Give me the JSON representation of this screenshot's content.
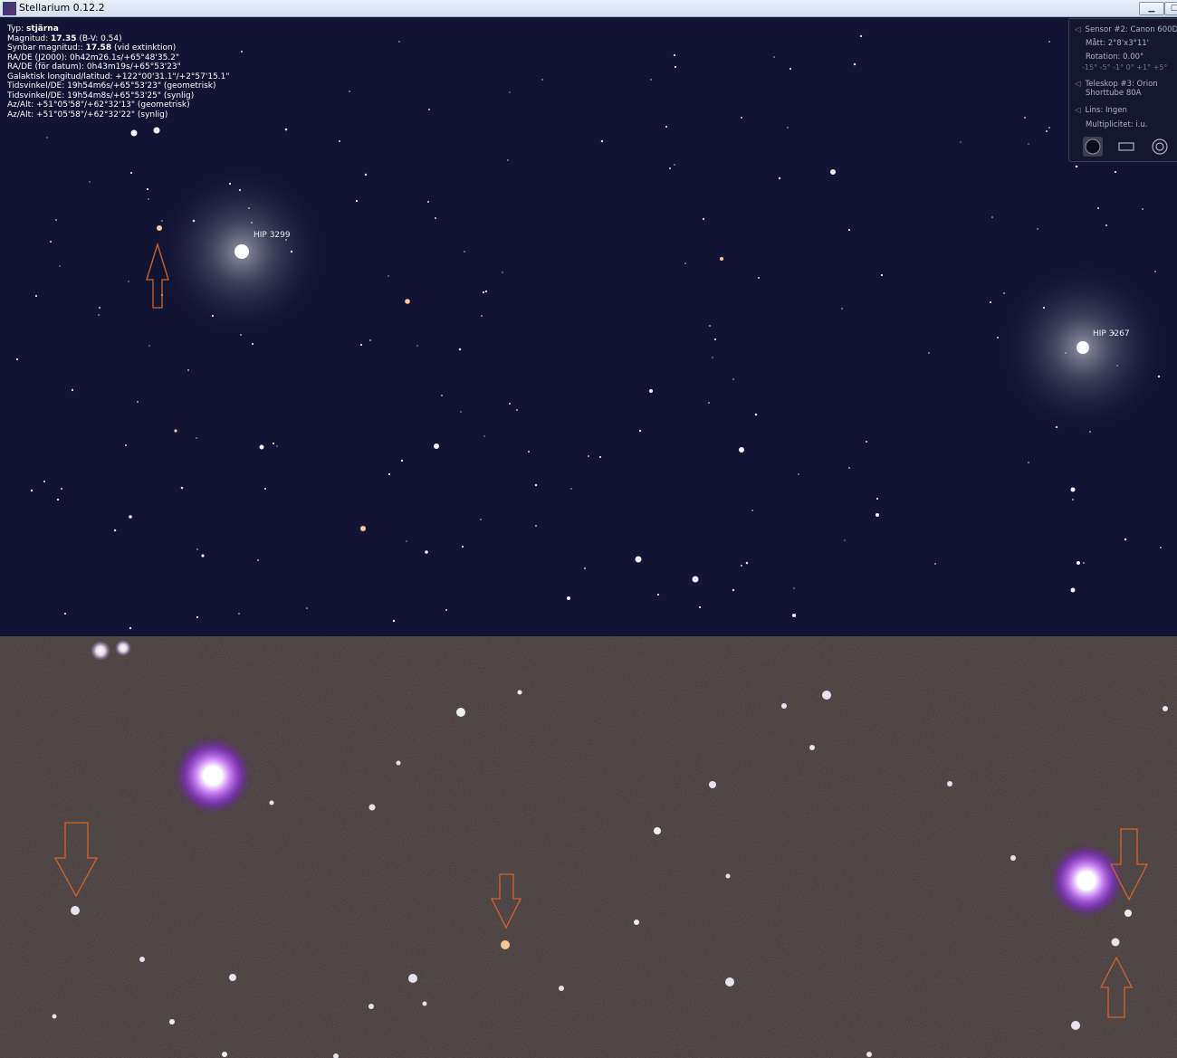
{
  "window": {
    "title": "Stellarium 0.12.2"
  },
  "info": {
    "type_label": "Typ: ",
    "type_value": "stjärna",
    "mag_label": "Magnitud: ",
    "mag_value": "17.35",
    "mag_bv": " (B-V: 0.54)",
    "app_mag_label": "Synbar magnitud:: ",
    "app_mag_value": "17.58",
    "app_mag_note": " (vid extinktion)",
    "line_radec_j2000": "RA/DE (J2000): 0h42m26.1s/+65°48'35.2\"",
    "line_radec_date": "RA/DE (för datum): 0h43m19s/+65°53'23\"",
    "line_galactic": "Galaktisk longitud/latitud: +122°00'31.1\"/+2°57'15.1\"",
    "line_hour_geo": "Tidsvinkel/DE: 19h54m6s/+65°53'23\" (geometrisk)",
    "line_hour_app": "Tidsvinkel/DE: 19h54m8s/+65°53'25\" (synlig)",
    "line_azalt_geo": "Az/Alt: +51°05'58\"/+62°32'13\" (geometrisk)",
    "line_azalt_app": "Az/Alt: +51°05'58\"/+62°32'22\" (synlig)"
  },
  "labels": {
    "hip_3299": "HIP 3299",
    "hip_3267": "HIP 3267"
  },
  "ocular_panel": {
    "sensor": "Sensor #2: Canon 600D",
    "size": "Mått: 2°8'x3°11'",
    "rotation": "Rotation: 0.00°",
    "rotation_scale": "-15° -5° -1° 0° +1° +5°",
    "telescope_line1": "Teleskop #3: Orion",
    "telescope_line2": "Shorttube 80A",
    "lens": "Lins: Ingen",
    "multiplicity": "Multiplicitet: i.u.",
    "icons": [
      "sensor-mode-icon",
      "ccd-frame-icon",
      "ocular-icon"
    ]
  },
  "colors": {
    "sky_background": "#111533",
    "marker_arrow": "#d4642a",
    "photo_background": "#3f3535",
    "bright_star_photo": "#b043ff"
  }
}
